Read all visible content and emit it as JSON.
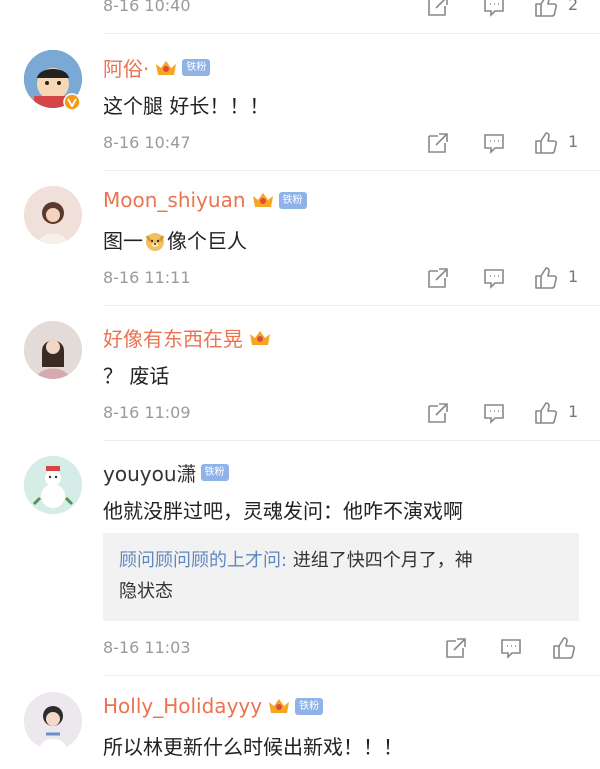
{
  "colors": {
    "username": "#eb7350",
    "meta": "#9a9a9a",
    "fan_badge": "#8fb2e8",
    "quote_name": "#5f87c2",
    "divider": "#ececec"
  },
  "top_partial": {
    "time": "8-16 10:40",
    "likes": "2"
  },
  "comments": [
    {
      "name": "阿俗·",
      "badge": "铁粉",
      "text": "这个腿 好长！！！",
      "time": "8-16 10:47",
      "likes": "1",
      "avatar_icon": "cartoon-avatar"
    },
    {
      "name": "Moon_shiyuan",
      "badge": "铁粉",
      "text_before": "图一",
      "text_after": "像个巨人",
      "emoji": "doge-icon",
      "time": "8-16 11:11",
      "likes": "1",
      "avatar_icon": "girl-avatar"
    },
    {
      "name": "好像有东西在晃",
      "text": "？ 废话",
      "time": "8-16 11:09",
      "likes": "1",
      "avatar_icon": "portrait-avatar"
    },
    {
      "name": "youyou潇",
      "badge": "铁粉",
      "text": "他就没胖过吧，灵魂发问：他咋不演戏啊",
      "quote_name": "顾问顾问顾的上才问:",
      "quote_text_line1": " 进组了快四个月了，神",
      "quote_text_line2": "隐状态",
      "time": "8-16 11:03",
      "likes": "",
      "avatar_icon": "snowman-avatar"
    },
    {
      "name": "Holly_Holidayyy",
      "badge": "铁粉",
      "text": "所以林更新什么时候出新戏！！！",
      "avatar_icon": "child-avatar"
    }
  ]
}
